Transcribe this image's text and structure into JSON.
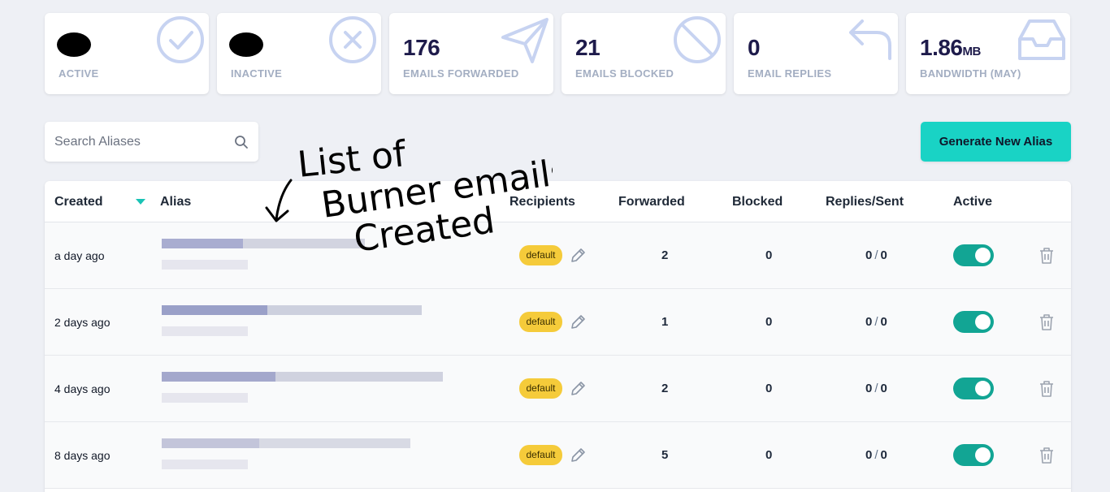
{
  "stats": [
    {
      "value": "",
      "label": "ACTIVE",
      "icon": "check-circle-icon"
    },
    {
      "value": "",
      "label": "INACTIVE",
      "icon": "x-circle-icon"
    },
    {
      "value": "176",
      "label": "EMAILS FORWARDED",
      "icon": "paper-plane-icon"
    },
    {
      "value": "21",
      "label": "EMAILS BLOCKED",
      "icon": "block-icon"
    },
    {
      "value": "0",
      "label": "EMAIL REPLIES",
      "icon": "reply-icon"
    },
    {
      "value": "1.86",
      "unit": "MB",
      "label": "BANDWIDTH (MAY)",
      "icon": "inbox-icon"
    }
  ],
  "search": {
    "placeholder": "Search Aliases"
  },
  "generate_button": "Generate New Alias",
  "table": {
    "headers": [
      "Created",
      "Alias",
      "Recipients",
      "Forwarded",
      "Blocked",
      "Replies/Sent",
      "Active"
    ],
    "rows": [
      {
        "created": "a day ago",
        "recipient": "default",
        "forwarded": "2",
        "blocked": "0",
        "replies": "0",
        "sent": "0",
        "active": true
      },
      {
        "created": "2 days ago",
        "recipient": "default",
        "forwarded": "1",
        "blocked": "0",
        "replies": "0",
        "sent": "0",
        "active": true
      },
      {
        "created": "4 days ago",
        "recipient": "default",
        "forwarded": "2",
        "blocked": "0",
        "replies": "0",
        "sent": "0",
        "active": true
      },
      {
        "created": "8 days ago",
        "recipient": "default",
        "forwarded": "5",
        "blocked": "0",
        "replies": "0",
        "sent": "0",
        "active": true
      }
    ]
  },
  "annotation": {
    "line1": "List of",
    "line2": "Burner emails",
    "line3": "Created"
  },
  "colors": {
    "accent": "#19d3c5",
    "toggle": "#12a594",
    "badge": "#f5cb3a",
    "icon": "#c7d3f1"
  }
}
